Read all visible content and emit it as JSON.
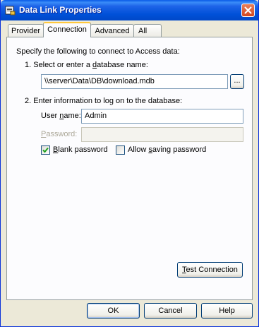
{
  "window": {
    "title": "Data Link Properties"
  },
  "tabs": [
    {
      "label": "Provider"
    },
    {
      "label": "Connection"
    },
    {
      "label": "Advanced"
    },
    {
      "label": "All"
    }
  ],
  "connection": {
    "intro": "Specify the following to connect to Access data:",
    "step1_pre": "1. Select or enter a ",
    "step1_u": "d",
    "step1_post": "atabase name:",
    "database_value": "\\\\server\\Data\\DB\\download.mdb",
    "browse_label": "...",
    "step2": "2. Enter information to log on to the database:",
    "username_pre": "User ",
    "username_u": "n",
    "username_post": "ame:",
    "username_value": "Admin",
    "password_u": "P",
    "password_post": "assword:",
    "password_value": "",
    "blank_password_u": "B",
    "blank_password_post": "lank password",
    "blank_password_checked": true,
    "allow_saving_pre": "Allow ",
    "allow_saving_u": "s",
    "allow_saving_post": "aving password",
    "allow_saving_checked": false,
    "test_u": "T",
    "test_post": "est Connection"
  },
  "buttons": {
    "ok": "OK",
    "cancel": "Cancel",
    "help": "Help"
  }
}
